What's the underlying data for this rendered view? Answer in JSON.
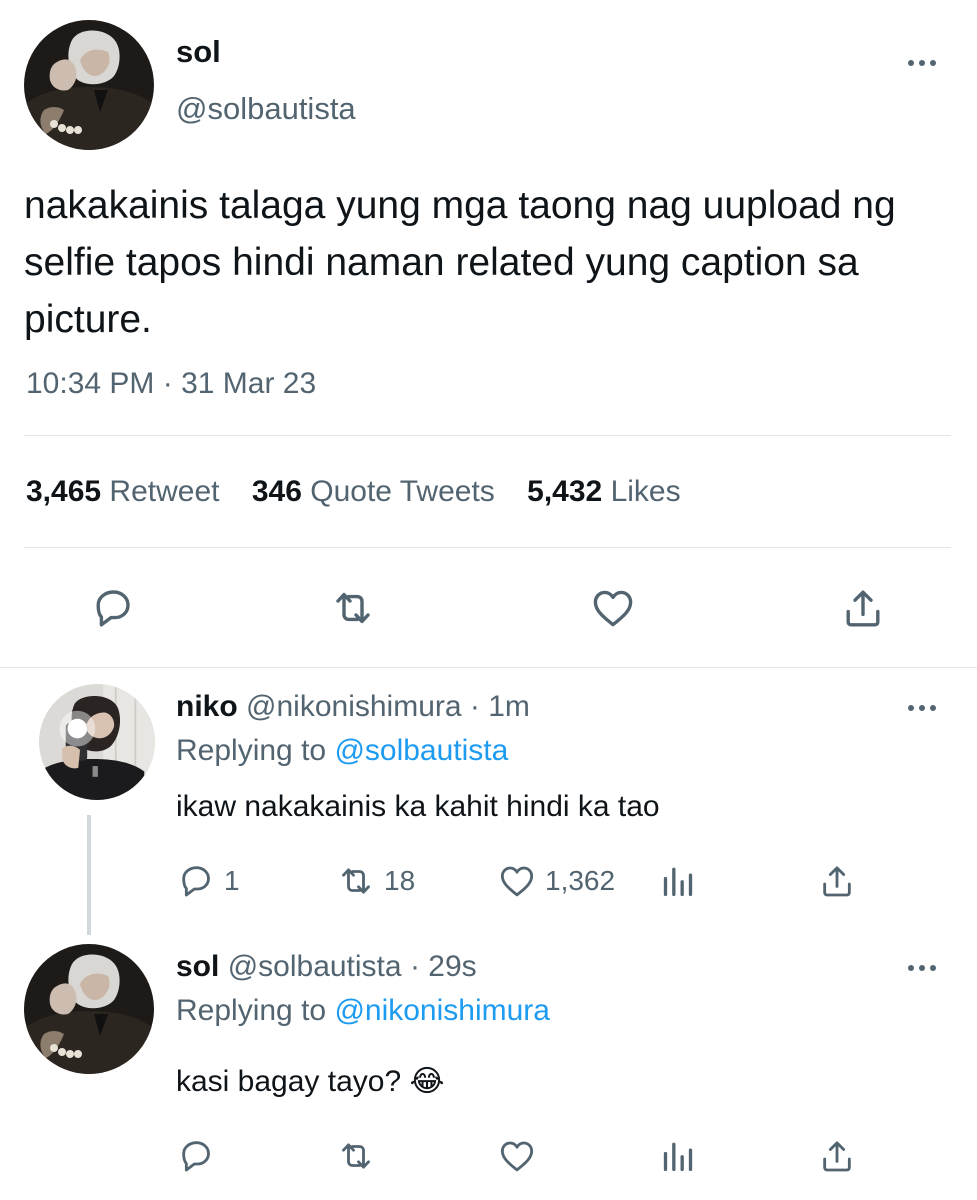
{
  "main_tweet": {
    "display_name": "sol",
    "handle": "@solbautista",
    "text": "nakakainis talaga yung mga taong nag uupload ng selfie tapos hindi naman related yung caption sa picture.",
    "timestamp": "10:34 PM · 31 Mar 23",
    "stats": {
      "retweets_count": "3,465",
      "retweets_label": "Retweet",
      "quotes_count": "346",
      "quotes_label": "Quote Tweets",
      "likes_count": "5,432",
      "likes_label": "Likes"
    },
    "actions": [
      "reply-icon",
      "retweet-icon",
      "like-icon",
      "share-icon"
    ]
  },
  "replies": [
    {
      "display_name": "niko",
      "handle": "@nikonishimura",
      "time": "· 1m",
      "replying_prefix": "Replying to",
      "replying_handle": "@solbautista",
      "text": "ikaw nakakainis ka kahit hindi ka tao",
      "reply_count": "1",
      "retweet_count": "18",
      "like_count": "1,362"
    },
    {
      "display_name": "sol",
      "handle": "@solbautista",
      "time": "· 29s",
      "replying_prefix": "Replying to",
      "replying_handle": "@nikonishimura",
      "text": "kasi bagay tayo?",
      "emoji": "😂",
      "reply_count": "",
      "retweet_count": "",
      "like_count": ""
    }
  ],
  "colors": {
    "text": "#0f1419",
    "muted": "#536471",
    "accent": "#1d9bf0",
    "divider": "#e1e6ea"
  }
}
